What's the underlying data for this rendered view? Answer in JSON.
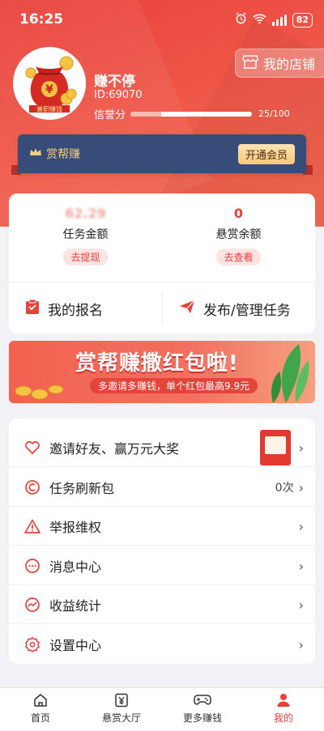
{
  "status": {
    "time": "16:25",
    "battery": "82"
  },
  "header": {
    "shop_label": "我的店铺"
  },
  "user": {
    "name": "赚不停",
    "id": "ID:69070",
    "credit_label": "信誉分",
    "credit_value": 25,
    "credit_max": 100,
    "credit_text": "25/100",
    "avatar_text": "兼职赚钱",
    "avatar_symbol": "¥"
  },
  "vip": {
    "title": "赏帮赚",
    "open_label": "开通会员"
  },
  "wallet": {
    "task_amount_value": "62.29",
    "task_amount_label": "任务金额",
    "withdraw_label": "去提现",
    "reward_balance_value": "0",
    "reward_balance_label": "悬赏余额",
    "view_label": "去查看"
  },
  "actions": {
    "my_signup": "我的报名",
    "publish": "发布/管理任务"
  },
  "banner": {
    "title": "赏帮赚撒红包啦!",
    "subtitle": "多邀请多赚钱，单个红包最高9.9元"
  },
  "menu": {
    "items": [
      {
        "label": "邀请好友、赢万元大奖",
        "value": ""
      },
      {
        "label": "任务刷新包",
        "value": "0次"
      },
      {
        "label": "举报维权",
        "value": ""
      },
      {
        "label": "消息中心",
        "value": ""
      },
      {
        "label": "收益统计",
        "value": ""
      },
      {
        "label": "设置中心",
        "value": ""
      }
    ]
  },
  "tabs": [
    {
      "label": "首页",
      "icon": "home-icon"
    },
    {
      "label": "悬赏大厅",
      "icon": "yen-icon"
    },
    {
      "label": "更多赚钱",
      "icon": "gamepad-icon"
    },
    {
      "label": "我的",
      "icon": "user-icon"
    }
  ],
  "colors": {
    "brand": "#e8403a",
    "vip_bg": "#384c7a",
    "vip_gold": "#f4cf7b"
  }
}
